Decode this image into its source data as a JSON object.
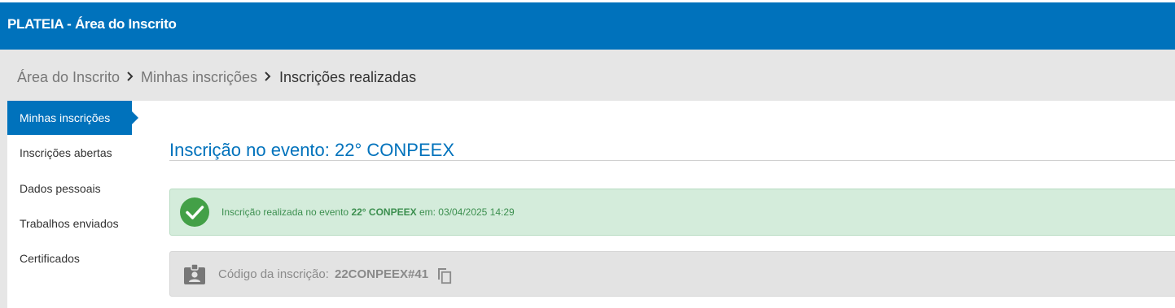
{
  "header": {
    "title": "PLATEIA - Área do Inscrito"
  },
  "breadcrumb": {
    "items": [
      "Área do Inscrito",
      "Minhas inscrições",
      "Inscrições realizadas"
    ]
  },
  "sidebar": {
    "items": [
      {
        "label": "Minhas inscrições",
        "active": true
      },
      {
        "label": "Inscrições abertas",
        "active": false
      },
      {
        "label": "Dados pessoais",
        "active": false
      },
      {
        "label": "Trabalhos enviados",
        "active": false
      },
      {
        "label": "Certificados",
        "active": false
      }
    ]
  },
  "main": {
    "title_prefix": "Inscrição no evento:",
    "event_name": "22° CONPEEX",
    "alert": {
      "prefix": "Inscrição realizada no evento",
      "event_name": "22° CONPEEX",
      "suffix": "em: 03/04/2025 14:29"
    },
    "registration": {
      "label": "Código da inscrição:",
      "code": "22CONPEEX#41"
    }
  },
  "icons": {
    "breadcrumb_separator": "chevron-right-icon",
    "success": "check-circle-icon",
    "badge": "id-badge-icon",
    "copy": "copy-icon"
  },
  "colors": {
    "primary": "#0072bc",
    "success_bg": "#d4ecdb",
    "success_text": "#3c8f4f",
    "success_icon": "#43a047"
  }
}
